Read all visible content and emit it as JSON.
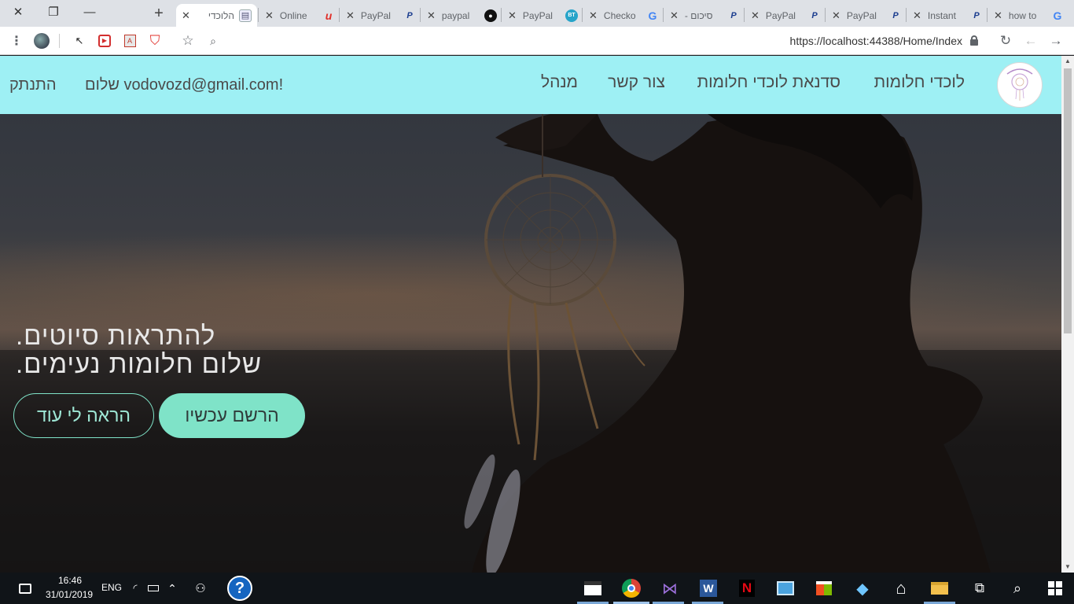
{
  "browser": {
    "tabs": [
      {
        "title": "הלוכדי",
        "favicon": "document-icon",
        "active": true
      },
      {
        "title": "Online",
        "favicon": "u-red-icon"
      },
      {
        "title": "PayPal",
        "favicon": "paypal-icon"
      },
      {
        "title": "paypal",
        "favicon": "github-icon"
      },
      {
        "title": "PayPal",
        "favicon": "bt-icon"
      },
      {
        "title": "Checko",
        "favicon": "google-icon"
      },
      {
        "title": "סיכום -",
        "favicon": "paypal-icon"
      },
      {
        "title": "PayPal",
        "favicon": "paypal-icon"
      },
      {
        "title": "PayPal",
        "favicon": "paypal-icon"
      },
      {
        "title": "Instant",
        "favicon": "paypal-icon"
      },
      {
        "title": "how to",
        "favicon": "google-icon"
      }
    ],
    "new_tab": "+",
    "url": "https://localhost:44388/Home/Index"
  },
  "site": {
    "nav": {
      "brand": "לוכדי חלומות",
      "workshop": "סדנאת לוכדי חלומות",
      "contact": "צור קשר",
      "admin": "מנהל",
      "greeting": "שלום vodovozd@gmail.com!",
      "logout": "התנתק"
    },
    "hero": {
      "line1": "להתראות סיוטים.",
      "line2": "שלום חלומות נעימים.",
      "register": "הרשם עכשיו",
      "more": "הראה לי עוד"
    }
  },
  "taskbar": {
    "time": "16:46",
    "date": "31/01/2019",
    "lang": "ENG"
  },
  "colors": {
    "nav_bg": "#9ef0f4",
    "accent": "#7fe3c8",
    "tabstrip": "#dee1e6",
    "taskbar": "#101418"
  }
}
